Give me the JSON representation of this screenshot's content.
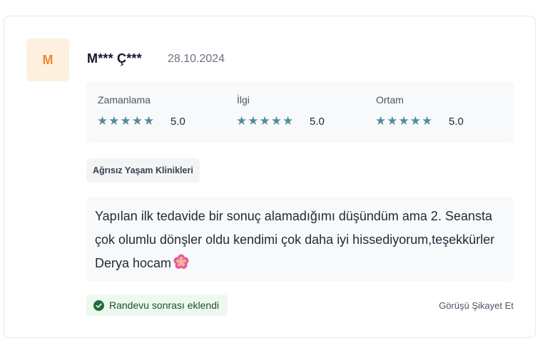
{
  "review": {
    "avatar_initial": "M",
    "author": "M*** Ç***",
    "date": "28.10.2024",
    "ratings": [
      {
        "label": "Zamanlama",
        "stars": 5,
        "score": "5.0"
      },
      {
        "label": "İlgi",
        "stars": 5,
        "score": "5.0"
      },
      {
        "label": "Ortam",
        "stars": 5,
        "score": "5.0"
      }
    ],
    "clinic": "Ağrısız Yaşam Klinikleri",
    "comment": "Yapılan ilk tedavide bir sonuç alamadığımı düşündüm ama 2. Seansta çok olumlu dönşler oldu kendimi çok daha iyi hissediyorum,teşekkürler Derya hocam",
    "comment_emoji": "hibiscus-icon",
    "verified_badge": "Randevu sonrası eklendi",
    "report_link": "Görüşü Şikayet Et"
  },
  "colors": {
    "avatar_bg": "#fdf0df",
    "avatar_text": "#ee8b2a",
    "star": "#4f8f98",
    "badge_bg": "#edf8ef",
    "badge_check": "#1f6f3a"
  }
}
